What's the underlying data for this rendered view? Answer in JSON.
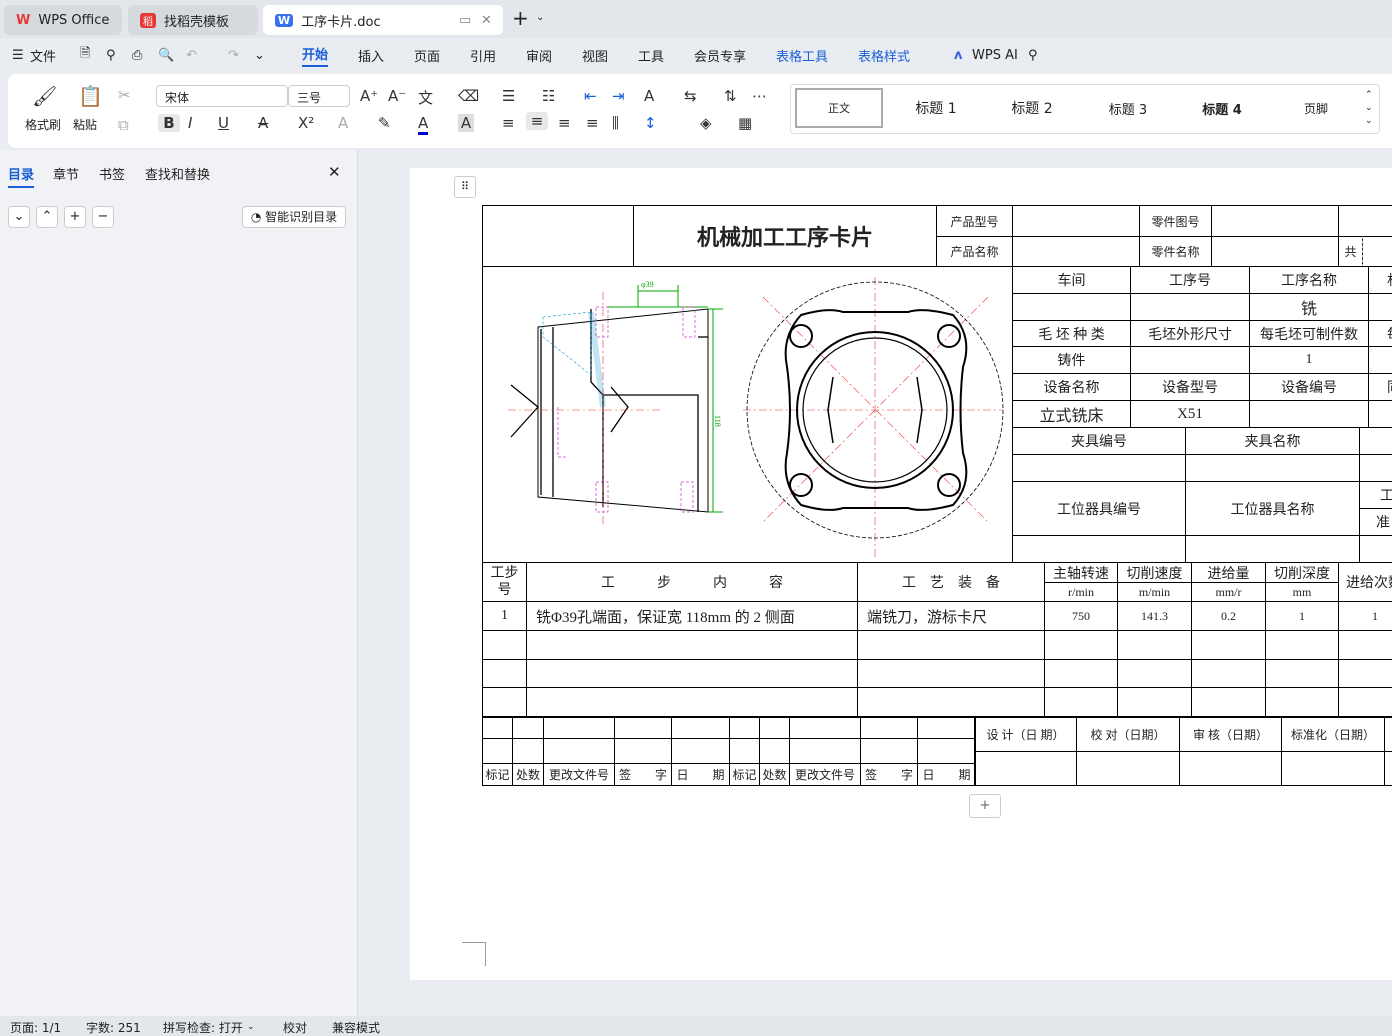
{
  "tabs": [
    {
      "label": "WPS Office",
      "icon": "wps-logo-icon"
    },
    {
      "label": "找稻壳模板",
      "icon": "docer-icon"
    },
    {
      "label": "工序卡片.doc",
      "icon": "word-doc-icon",
      "active": true
    }
  ],
  "menu": {
    "file": "文件",
    "items": [
      "开始",
      "插入",
      "页面",
      "引用",
      "审阅",
      "视图",
      "工具",
      "会员专享",
      "表格工具",
      "表格样式"
    ],
    "active": "开始",
    "ai": "WPS AI"
  },
  "ribbon": {
    "format_painter": "格式刷",
    "paste": "粘贴",
    "font": "宋体",
    "size": "三号",
    "styles": [
      "正文",
      "标题 1",
      "标题 2",
      "标题 3",
      "标题 4",
      "页脚"
    ]
  },
  "sidebar": {
    "tabs": [
      "目录",
      "章节",
      "书签",
      "查找和替换"
    ],
    "active": "目录",
    "smart_toc": "智能识别目录"
  },
  "card": {
    "title": "机械加工工序卡片",
    "h": {
      "product_model": "产品型号",
      "product_name": "产品名称",
      "part_no": "零件图号",
      "part_name": "零件名称",
      "total": "共"
    },
    "info": {
      "workshop": "车间",
      "op_no": "工序号",
      "op_name": "工序名称",
      "op_name_val": "铣",
      "blank_type": "毛 坯 种 类",
      "blank_size": "毛坯外形尺寸",
      "per_blank": "每毛坯可制件数",
      "blank_type_val": "铸件",
      "per_blank_val": "1",
      "equip_name": "设备名称",
      "equip_model": "设备型号",
      "equip_no": "设备编号",
      "equip_name_val": "立式铣床",
      "equip_model_val": "X51",
      "fixture_no": "夹具编号",
      "fixture_name": "夹具名称",
      "station_no": "工位器具编号",
      "station_name": "工位器具名称",
      "cut1": "工",
      "cut2": "准",
      "cut3": "村",
      "cut4": "每",
      "cut5": "同"
    },
    "steps_header": {
      "no": "工步号",
      "content": "工　　　步　　　内　　　容",
      "equip": "工　艺　装　备",
      "spindle": "主轴转速",
      "spindle_u": "r/min",
      "speed": "切削速度",
      "speed_u": "m/min",
      "feed": "进给量",
      "feed_u": "mm/r",
      "depth": "切削深度",
      "depth_u": "mm",
      "passes": "进给次数"
    },
    "steps": [
      {
        "no": "1",
        "content": "铣Φ39孔端面，保证宽 118mm 的 2 侧面",
        "equip": "端铣刀，游标卡尺",
        "spindle": "750",
        "speed": "141.3",
        "feed": "0.2",
        "depth": "1",
        "passes": "1"
      }
    ],
    "footer": {
      "labels": [
        "标记",
        "处数",
        "更改文件号",
        "签　　字",
        "日　　期",
        "标记",
        "处数",
        "更改文件号",
        "签　　字",
        "日　　期"
      ],
      "sign": [
        "设 计（日 期）",
        "校 对（日期）",
        "审 核（日期）",
        "标准化（日期）"
      ]
    },
    "drawing": {
      "dim1": "φ39",
      "dim2": "118"
    }
  },
  "status": {
    "page": "页面: 1/1",
    "words": "字数: 251",
    "spell": "拼写检查: 打开",
    "proof": "校对",
    "compat": "兼容模式"
  }
}
